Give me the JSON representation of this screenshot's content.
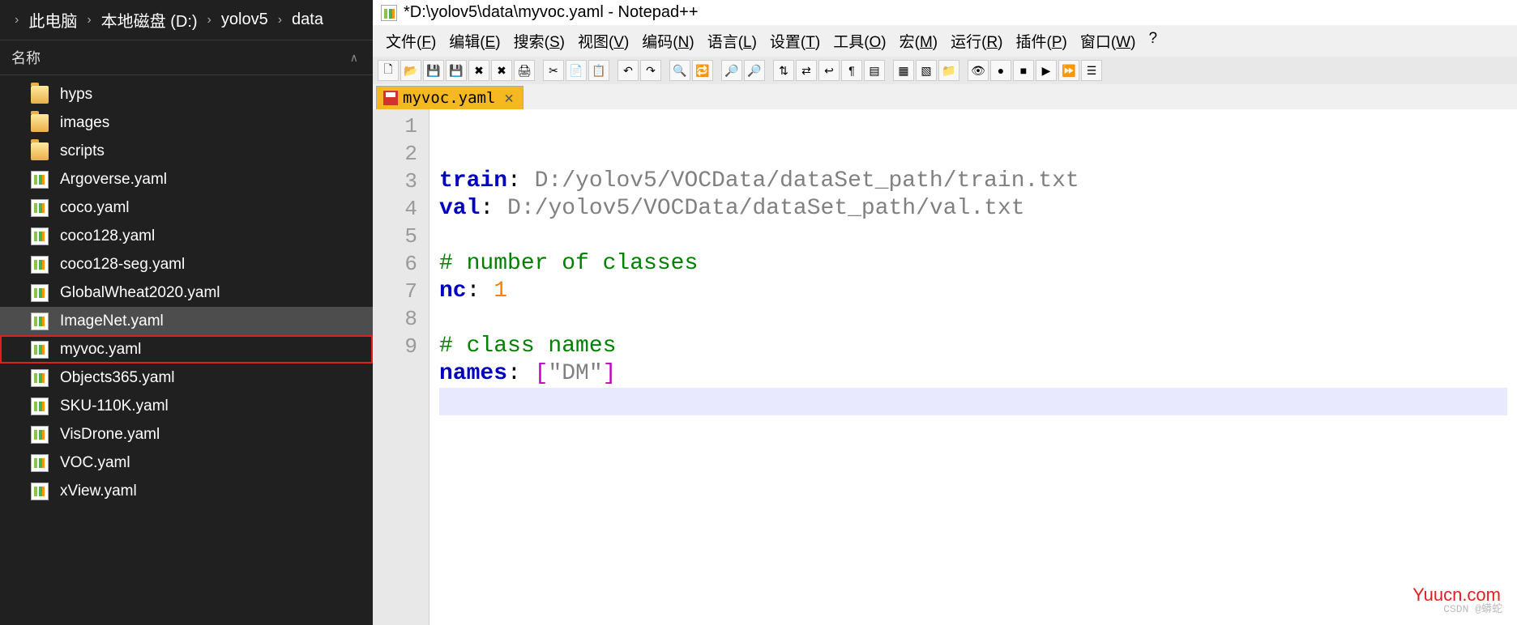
{
  "explorer": {
    "breadcrumb": [
      "此电脑",
      "本地磁盘 (D:)",
      "yolov5",
      "data"
    ],
    "column_header": "名称",
    "items": [
      {
        "name": "hyps",
        "type": "folder"
      },
      {
        "name": "images",
        "type": "folder"
      },
      {
        "name": "scripts",
        "type": "folder"
      },
      {
        "name": "Argoverse.yaml",
        "type": "yaml"
      },
      {
        "name": "coco.yaml",
        "type": "yaml"
      },
      {
        "name": "coco128.yaml",
        "type": "yaml"
      },
      {
        "name": "coco128-seg.yaml",
        "type": "yaml"
      },
      {
        "name": "GlobalWheat2020.yaml",
        "type": "yaml"
      },
      {
        "name": "ImageNet.yaml",
        "type": "yaml",
        "hovered": true
      },
      {
        "name": "myvoc.yaml",
        "type": "yaml",
        "highlighted": true
      },
      {
        "name": "Objects365.yaml",
        "type": "yaml"
      },
      {
        "name": "SKU-110K.yaml",
        "type": "yaml"
      },
      {
        "name": "VisDrone.yaml",
        "type": "yaml"
      },
      {
        "name": "VOC.yaml",
        "type": "yaml"
      },
      {
        "name": "xView.yaml",
        "type": "yaml"
      }
    ]
  },
  "editor": {
    "title": "*D:\\yolov5\\data\\myvoc.yaml - Notepad++",
    "menus": [
      {
        "label": "文件",
        "accel": "F"
      },
      {
        "label": "编辑",
        "accel": "E"
      },
      {
        "label": "搜索",
        "accel": "S"
      },
      {
        "label": "视图",
        "accel": "V"
      },
      {
        "label": "编码",
        "accel": "N"
      },
      {
        "label": "语言",
        "accel": "L"
      },
      {
        "label": "设置",
        "accel": "T"
      },
      {
        "label": "工具",
        "accel": "O"
      },
      {
        "label": "宏",
        "accel": "M"
      },
      {
        "label": "运行",
        "accel": "R"
      },
      {
        "label": "插件",
        "accel": "P"
      },
      {
        "label": "窗口",
        "accel": "W"
      },
      {
        "label": "?",
        "accel": ""
      }
    ],
    "tab_name": "myvoc.yaml",
    "tab_close": "✕",
    "lines": [
      {
        "n": 1,
        "tokens": [
          [
            "kw",
            "train"
          ],
          [
            "colon",
            ": "
          ],
          [
            "str",
            "D:/yolov5/VOCData/dataSet_path/train.txt"
          ]
        ]
      },
      {
        "n": 2,
        "tokens": [
          [
            "kw",
            "val"
          ],
          [
            "colon",
            ": "
          ],
          [
            "str",
            "D:/yolov5/VOCData/dataSet_path/val.txt"
          ]
        ]
      },
      {
        "n": 3,
        "tokens": []
      },
      {
        "n": 4,
        "tokens": [
          [
            "comment",
            "# number of classes"
          ]
        ]
      },
      {
        "n": 5,
        "tokens": [
          [
            "kw",
            "nc"
          ],
          [
            "colon",
            ": "
          ],
          [
            "num",
            "1"
          ]
        ]
      },
      {
        "n": 6,
        "tokens": []
      },
      {
        "n": 7,
        "tokens": [
          [
            "comment",
            "# class names"
          ]
        ]
      },
      {
        "n": 8,
        "tokens": [
          [
            "kw",
            "names"
          ],
          [
            "colon",
            ": "
          ],
          [
            "bracket",
            "["
          ],
          [
            "str",
            "\"DM\""
          ],
          [
            "bracket",
            "]"
          ]
        ]
      },
      {
        "n": 9,
        "tokens": [],
        "current": true
      }
    ],
    "toolbar_icons": [
      "new",
      "open",
      "save",
      "save-all",
      "close",
      "close-all",
      "print",
      "|",
      "cut",
      "copy",
      "paste",
      "|",
      "undo",
      "redo",
      "|",
      "find",
      "replace",
      "|",
      "zoom-in",
      "zoom-out",
      "|",
      "sync-v",
      "sync-h",
      "wrap",
      "all-chars",
      "indent-guide",
      "|",
      "fold",
      "unfold",
      "folder",
      "|",
      "hide",
      "record",
      "stop",
      "play",
      "play-multi",
      "macros"
    ]
  },
  "watermark": "Yuucn.com",
  "watermark2": "CSDN @蟒蛇"
}
